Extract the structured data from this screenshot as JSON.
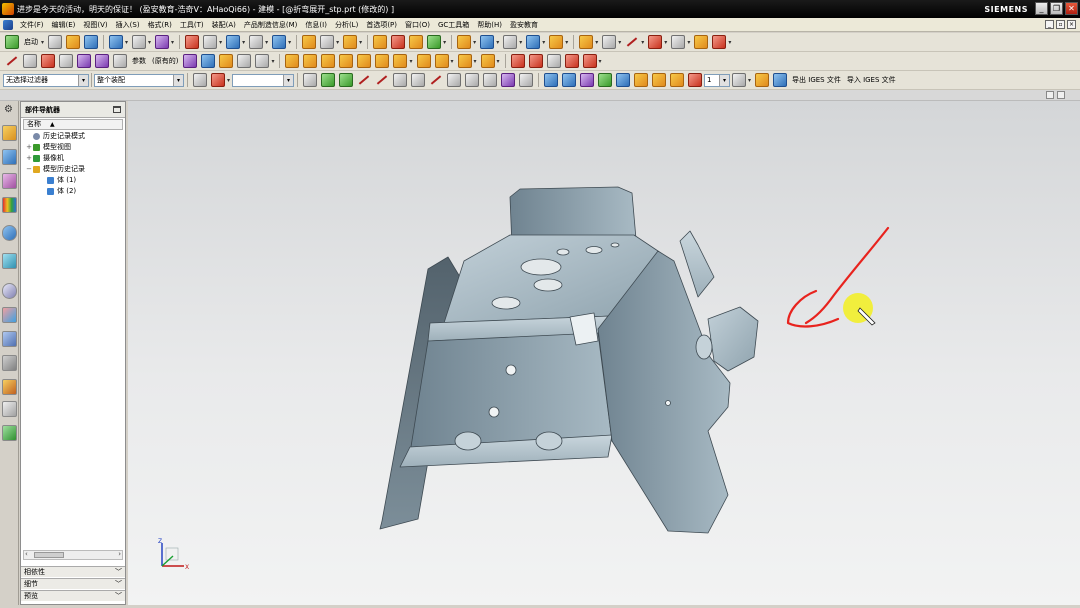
{
  "window": {
    "title": "进步是今天的活动，明天的保证！ (盈安教育-浩奇V：AHaoQi66) - 建模 - [@折弯展开_stp.prt (修改的) ]",
    "brand": "SIEMENS",
    "buttons": {
      "minimize": "_",
      "restore": "❐",
      "close": "✕"
    }
  },
  "menubar": {
    "items": [
      "文件(F)",
      "编辑(E)",
      "视图(V)",
      "插入(S)",
      "格式(R)",
      "工具(T)",
      "装配(A)",
      "产品制造信息(M)",
      "信息(I)",
      "分析(L)",
      "首选项(P)",
      "窗口(O)",
      "GC工具箱",
      "帮助(H)",
      "盈安教育"
    ]
  },
  "toolbar1": {
    "start_label": "启动"
  },
  "toolbar2": {
    "params_label": "参数",
    "params_sub": "(原有的)"
  },
  "toolbar3": {
    "selection_filter": "无选择过滤器",
    "assembly_scope": "整个装配",
    "layer_value": "1",
    "export_iges": "导出 IGES 文件",
    "import_iges": "导入 IGES 文件"
  },
  "navigator": {
    "title": "部件导航器",
    "column_name": "名称",
    "tree": [
      {
        "label": "历史记录模式",
        "indent": 0,
        "icon": "clock-icon",
        "expander": ""
      },
      {
        "label": "模型视图",
        "indent": 0,
        "icon": "view-icon",
        "expander": "+"
      },
      {
        "label": "摄像机",
        "indent": 0,
        "icon": "camera-icon",
        "expander": "+"
      },
      {
        "label": "模型历史记录",
        "indent": 0,
        "icon": "folder-icon",
        "expander": "−"
      },
      {
        "label": "体 (1)",
        "indent": 1,
        "icon": "body-icon",
        "expander": ""
      },
      {
        "label": "体 (2)",
        "indent": 1,
        "icon": "body-icon",
        "expander": ""
      }
    ],
    "sections": [
      "相依性",
      "细节",
      "预览"
    ]
  },
  "viewport": {
    "annotation_color": "#e8231e",
    "part_color": "#9fb1bb"
  }
}
